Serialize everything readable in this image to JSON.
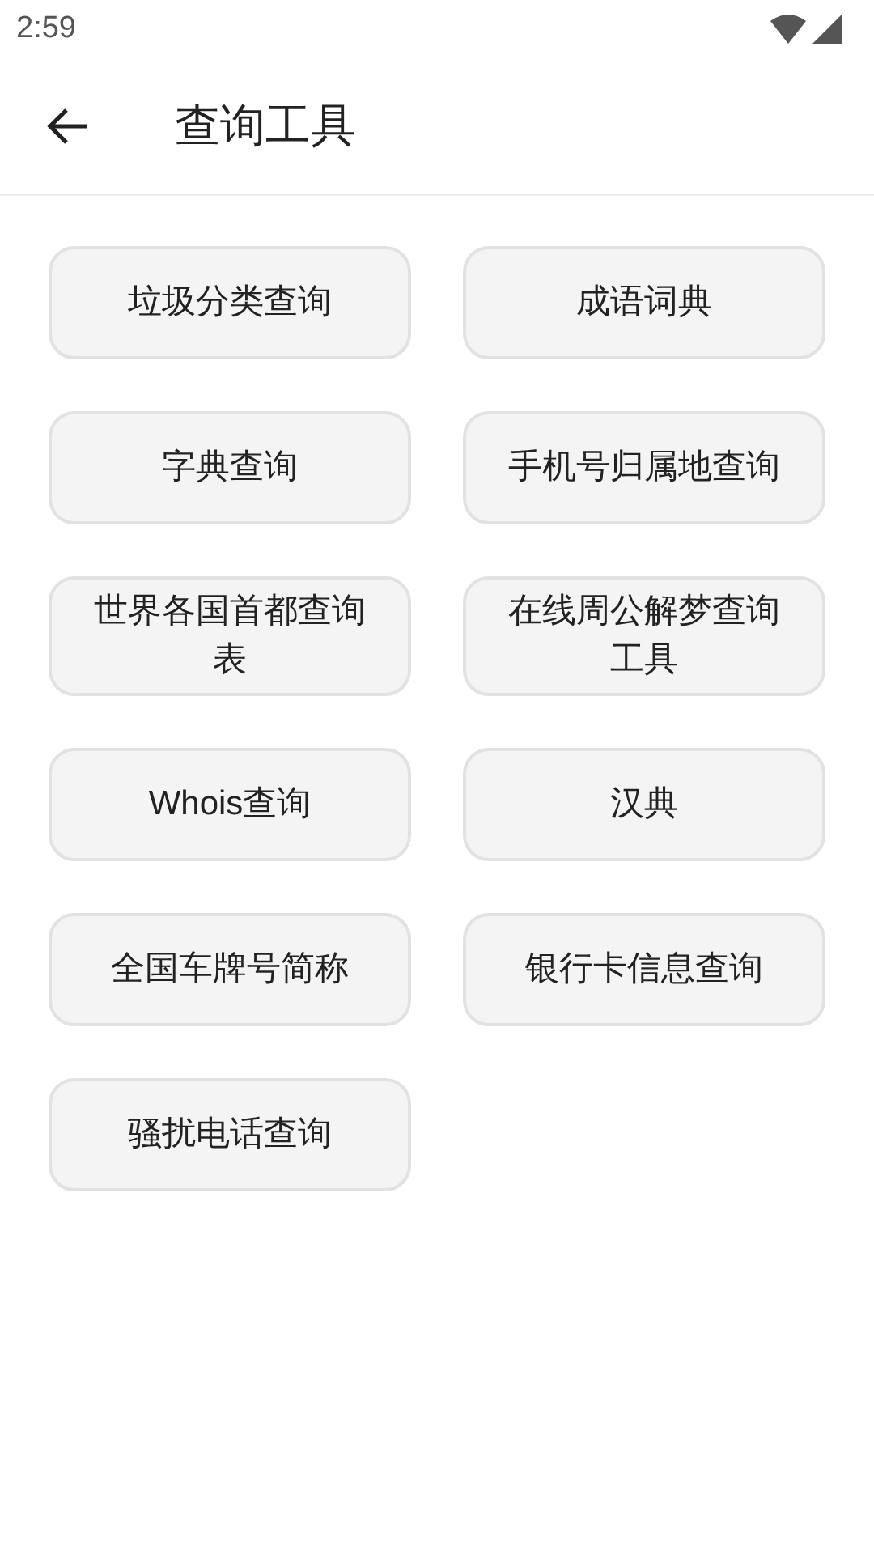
{
  "status_bar": {
    "time": "2:59"
  },
  "app_bar": {
    "title": "查询工具"
  },
  "tools": [
    {
      "label": "垃圾分类查询"
    },
    {
      "label": "成语词典"
    },
    {
      "label": "字典查询"
    },
    {
      "label": "手机号归属地查询"
    },
    {
      "label": "世界各国首都查询表"
    },
    {
      "label": "在线周公解梦查询工具"
    },
    {
      "label": "Whois查询"
    },
    {
      "label": "汉典"
    },
    {
      "label": "全国车牌号简称"
    },
    {
      "label": "银行卡信息查询"
    },
    {
      "label": "骚扰电话查询"
    }
  ]
}
